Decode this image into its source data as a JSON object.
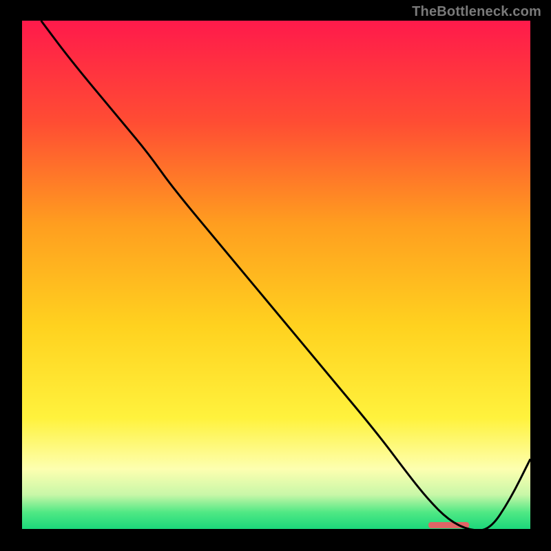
{
  "attribution": "TheBottleneck.com",
  "colors": {
    "gradient_stops": [
      {
        "offset": 0.0,
        "color": "#ff1a4b"
      },
      {
        "offset": 0.2,
        "color": "#ff4d33"
      },
      {
        "offset": 0.4,
        "color": "#ff9e1f"
      },
      {
        "offset": 0.6,
        "color": "#ffd21f"
      },
      {
        "offset": 0.78,
        "color": "#fff23d"
      },
      {
        "offset": 0.88,
        "color": "#fdffb0"
      },
      {
        "offset": 0.93,
        "color": "#c9f7a8"
      },
      {
        "offset": 0.965,
        "color": "#4fe884"
      },
      {
        "offset": 1.0,
        "color": "#17d67a"
      }
    ],
    "line": "#000000",
    "marker": "#e06666",
    "axis": "#000000",
    "background": "#000000"
  },
  "chart_data": {
    "type": "line",
    "title": "",
    "xlabel": "",
    "ylabel": "",
    "xlim": [
      0,
      100
    ],
    "ylim": [
      0,
      100
    ],
    "x": [
      4,
      10,
      20,
      25,
      30,
      40,
      50,
      60,
      70,
      76,
      80,
      84,
      88,
      92,
      96,
      100
    ],
    "values": [
      100,
      92,
      80,
      74,
      67,
      55,
      43,
      31,
      19,
      11,
      6,
      2,
      0,
      0,
      6,
      14
    ],
    "marker_range_x": [
      80,
      88
    ],
    "grid": false,
    "legend": false
  }
}
